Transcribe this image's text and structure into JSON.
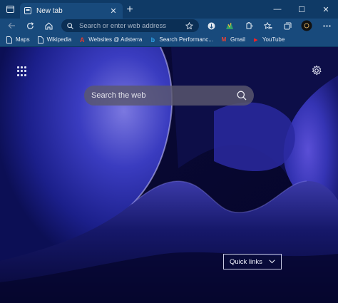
{
  "tab": {
    "title": "New tab",
    "close": "✕"
  },
  "window": {
    "new_tab": "+",
    "minimize": "—",
    "maximize": "☐",
    "close": "✕"
  },
  "toolbar": {
    "address_placeholder": "Search or enter web address"
  },
  "bookmarks": [
    {
      "label": "Maps",
      "icon": "page-icon"
    },
    {
      "label": "Wikipedia",
      "icon": "page-icon"
    },
    {
      "label": "Websites @ Adsterra",
      "icon": "adsterra-icon",
      "glyph": "A",
      "color": "#e53a2e"
    },
    {
      "label": "Search Performanc...",
      "icon": "bing-icon",
      "glyph": "b",
      "color": "#2fa3e8"
    },
    {
      "label": "Gmail",
      "icon": "gmail-icon",
      "glyph": "M",
      "color": "#ea4335"
    },
    {
      "label": "YouTube",
      "icon": "youtube-icon",
      "glyph": "▶",
      "color": "#ff0000"
    }
  ],
  "page": {
    "search_placeholder": "Search the web",
    "quick_links": "Quick links"
  },
  "colors": {
    "titlebar": "#0f3a66",
    "toolbar": "#184a7c",
    "page_bg": "#04042a"
  }
}
